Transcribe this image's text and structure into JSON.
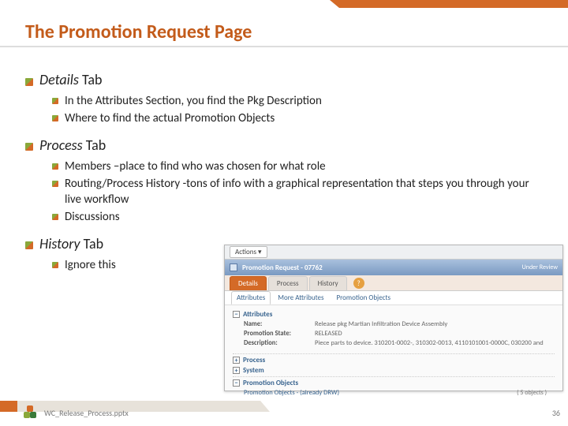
{
  "title": "The Promotion Request Page",
  "sections": {
    "details": {
      "heading_em": "Details",
      "heading_rest": " Tab",
      "items": [
        "In the Attributes Section, you find the Pkg Description",
        "Where to find the actual Promotion Objects"
      ]
    },
    "process": {
      "heading_em": "Process",
      "heading_rest": " Tab",
      "items": [
        "Members –place to find who was chosen for what role",
        "Routing/Process History  -tons of info with a graphical representation that steps you through your live workflow",
        "Discussions"
      ]
    },
    "history": {
      "heading_em": "History",
      "heading_rest": " Tab",
      "items": [
        "Ignore this"
      ]
    }
  },
  "app": {
    "actions_label": "Actions ▾",
    "window_title": "Promotion Request - 07762",
    "status": "Under Review",
    "tabs": [
      "Details",
      "Process",
      "History"
    ],
    "subtabs": [
      "Attributes",
      "More Attributes",
      "Promotion Objects"
    ],
    "attributes_label": "Attributes",
    "fields": {
      "name_label": "Name:",
      "name_value": "Release pkg Martian Infiltration Device Assembly",
      "state_label": "Promotion State:",
      "state_value": "RELEASED",
      "desc_label": "Description:",
      "desc_value": "Piece parts to device. 310201-0002-, 310302-0013, 4110101001-0000C, 030200 and"
    },
    "process_label": "Process",
    "system_label": "System",
    "promo_objects_label": "Promotion Objects",
    "promo_link": "Promotion Objects - (already DRW)",
    "count": "( 5 objects )"
  },
  "footer": {
    "filename": "WC_Release_Process.pptx",
    "page": "36"
  }
}
